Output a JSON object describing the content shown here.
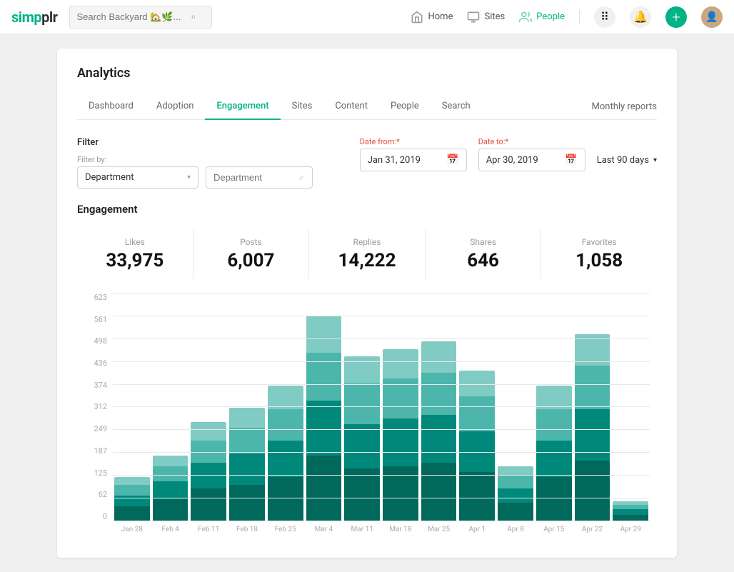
{
  "app": {
    "logo": "simpplr",
    "search_placeholder": "Search Backyard 🏡🌿...",
    "nav_items": [
      {
        "label": "Home",
        "icon": "home-icon"
      },
      {
        "label": "Sites",
        "icon": "sites-icon"
      },
      {
        "label": "People",
        "icon": "people-icon"
      }
    ]
  },
  "analytics": {
    "title": "Analytics",
    "tabs": [
      {
        "label": "Dashboard",
        "active": false
      },
      {
        "label": "Adoption",
        "active": false
      },
      {
        "label": "Engagement",
        "active": true
      },
      {
        "label": "Sites",
        "active": false
      },
      {
        "label": "Content",
        "active": false
      },
      {
        "label": "People",
        "active": false
      },
      {
        "label": "Search",
        "active": false
      }
    ],
    "monthly_reports_label": "Monthly reports",
    "filter": {
      "section_label": "Filter",
      "filter_by_label": "Filter by:",
      "filter_by_value": "Department",
      "department_placeholder": "Department",
      "date_range_label": "Last 90 days",
      "date_from_label": "Date from:",
      "date_from_value": "Jan 31, 2019",
      "date_to_label": "Date to:",
      "date_to_value": "Apr 30, 2019"
    },
    "engagement": {
      "section_label": "Engagement",
      "stats": [
        {
          "label": "Likes",
          "value": "33,975"
        },
        {
          "label": "Posts",
          "value": "6,007"
        },
        {
          "label": "Replies",
          "value": "14,222"
        },
        {
          "label": "Shares",
          "value": "646"
        },
        {
          "label": "Favorites",
          "value": "1,058"
        }
      ],
      "chart": {
        "y_labels": [
          "623",
          "561",
          "498",
          "436",
          "374",
          "312",
          "249",
          "187",
          "125",
          "62",
          "0"
        ],
        "x_labels": [
          "Jan 28",
          "Feb 4",
          "Feb 11",
          "Feb 18",
          "Feb 25",
          "Mar 4",
          "Mar 11",
          "Mar 18",
          "Mar 25",
          "Apr 1",
          "Apr 8",
          "Apr 15",
          "Apr 22",
          "Apr 29"
        ],
        "colors": {
          "dark": "#00695c",
          "mid": "#00897b",
          "light": "#4db6ac",
          "lighter": "#80cbc4"
        },
        "bars": [
          {
            "total": 120,
            "segs": [
              40,
              30,
              30,
              20
            ]
          },
          {
            "total": 180,
            "segs": [
              60,
              50,
              40,
              30
            ]
          },
          {
            "total": 270,
            "segs": [
              90,
              70,
              60,
              50
            ]
          },
          {
            "total": 310,
            "segs": [
              100,
              85,
              70,
              55
            ]
          },
          {
            "total": 370,
            "segs": [
              120,
              100,
              85,
              65
            ]
          },
          {
            "total": 560,
            "segs": [
              180,
              150,
              130,
              100
            ]
          },
          {
            "total": 450,
            "segs": [
              145,
              120,
              110,
              75
            ]
          },
          {
            "total": 470,
            "segs": [
              150,
              130,
              110,
              80
            ]
          },
          {
            "total": 490,
            "segs": [
              160,
              130,
              115,
              85
            ]
          },
          {
            "total": 410,
            "segs": [
              135,
              110,
              95,
              70
            ]
          },
          {
            "total": 150,
            "segs": [
              50,
              40,
              35,
              25
            ]
          },
          {
            "total": 370,
            "segs": [
              120,
              100,
              85,
              65
            ]
          },
          {
            "total": 510,
            "segs": [
              165,
              140,
              120,
              85
            ]
          },
          {
            "total": 55,
            "segs": [
              18,
              15,
              12,
              10
            ]
          }
        ]
      }
    }
  }
}
